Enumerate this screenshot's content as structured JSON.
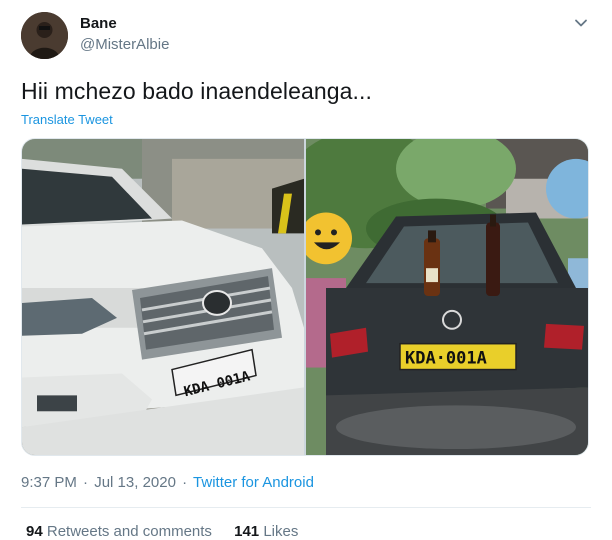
{
  "user": {
    "display_name": "Bane",
    "handle": "@MisterAlbie"
  },
  "tweet": {
    "text": "Hii mchezo bado inaendeleanga...",
    "translate_label": "Translate Tweet"
  },
  "media": {
    "left_plate": "KDA 001A",
    "right_plate": "KDA·001A"
  },
  "meta": {
    "time": "9:37 PM",
    "separator": "·",
    "date": "Jul 13, 2020",
    "separator2": "·",
    "source": "Twitter for Android"
  },
  "stats": {
    "retweets_count": "94",
    "retweets_label": "Retweets and comments",
    "likes_count": "141",
    "likes_label": "Likes"
  },
  "colors": {
    "link": "#1b95e0",
    "secondary_text": "#657786",
    "primary_text": "#14171a"
  },
  "icons": {
    "menu": "chevron-down-icon"
  }
}
